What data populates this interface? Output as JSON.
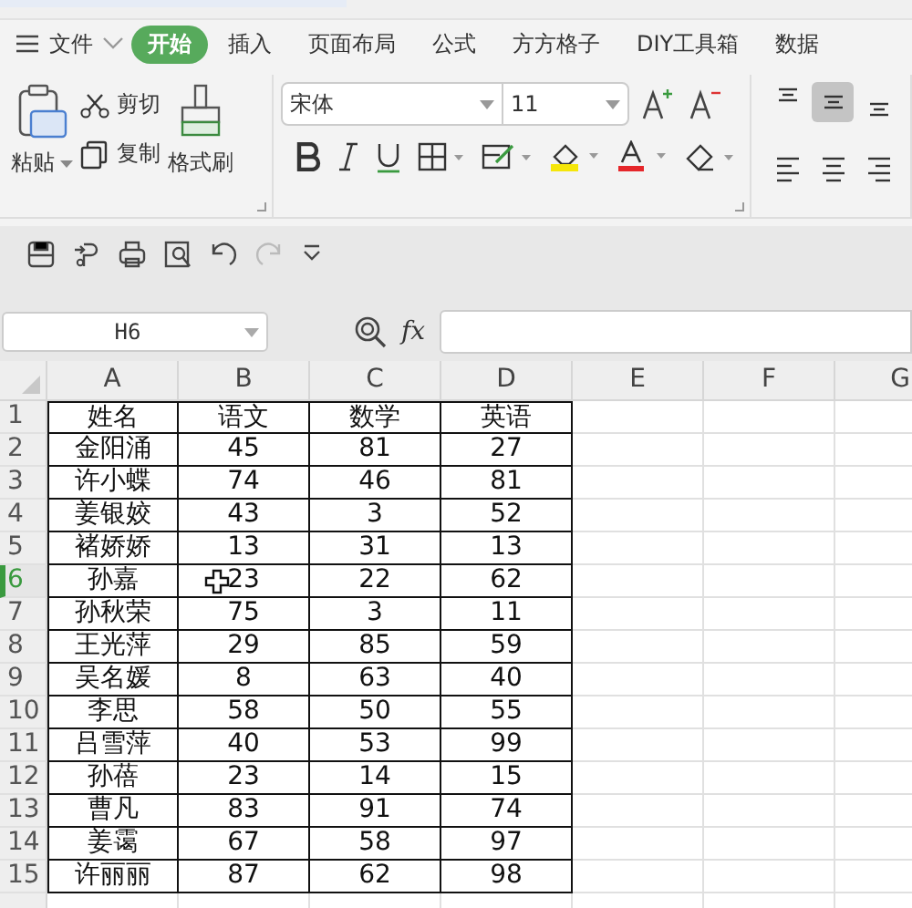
{
  "menu": {
    "label": "文件"
  },
  "tabs": [
    {
      "label": "开始",
      "selected": true
    },
    {
      "label": "插入",
      "selected": false
    },
    {
      "label": "页面布局",
      "selected": false
    },
    {
      "label": "公式",
      "selected": false
    },
    {
      "label": "方方格子",
      "selected": false
    },
    {
      "label": "DIY工具箱",
      "selected": false
    },
    {
      "label": "数据",
      "selected": false
    }
  ],
  "clipboard": {
    "paste": "粘贴",
    "cut": "剪切",
    "copy": "复制",
    "format_painter": "格式刷"
  },
  "font": {
    "name": "宋体",
    "size": "11"
  },
  "alignment": [
    {
      "kind": "top",
      "selected": false
    },
    {
      "kind": "middle",
      "selected": true
    },
    {
      "kind": "bottom",
      "selected": false
    },
    {
      "kind": "left",
      "selected": false
    },
    {
      "kind": "center",
      "selected": false
    },
    {
      "kind": "right",
      "selected": false
    }
  ],
  "name_box": {
    "value": "H6"
  },
  "formula_bar": {
    "label": "fx"
  },
  "sheet": {
    "columns": [
      "A",
      "B",
      "C",
      "D",
      "E",
      "F",
      "G"
    ],
    "rows": [
      {
        "number": "1",
        "selected": false,
        "cells": [
          "姓名",
          "语文",
          "数学",
          "英语"
        ]
      },
      {
        "number": "2",
        "selected": false,
        "cells": [
          "金阳涌",
          "45",
          "81",
          "27"
        ]
      },
      {
        "number": "3",
        "selected": false,
        "cells": [
          "许小蝶",
          "74",
          "46",
          "81"
        ]
      },
      {
        "number": "4",
        "selected": false,
        "cells": [
          "姜银姣",
          "43",
          "3",
          "52"
        ]
      },
      {
        "number": "5",
        "selected": false,
        "cells": [
          "褚娇娇",
          "13",
          "31",
          "13"
        ]
      },
      {
        "number": "6",
        "selected": true,
        "cells": [
          "孙嘉",
          "23",
          "22",
          "62"
        ]
      },
      {
        "number": "7",
        "selected": false,
        "cells": [
          "孙秋荣",
          "75",
          "3",
          "11"
        ]
      },
      {
        "number": "8",
        "selected": false,
        "cells": [
          "王光萍",
          "29",
          "85",
          "59"
        ]
      },
      {
        "number": "9",
        "selected": false,
        "cells": [
          "吴名媛",
          "8",
          "63",
          "40"
        ]
      },
      {
        "number": "10",
        "selected": false,
        "cells": [
          "李思",
          "58",
          "50",
          "55"
        ]
      },
      {
        "number": "11",
        "selected": false,
        "cells": [
          "吕雪萍",
          "40",
          "53",
          "99"
        ]
      },
      {
        "number": "12",
        "selected": false,
        "cells": [
          "孙蓓",
          "23",
          "14",
          "15"
        ]
      },
      {
        "number": "13",
        "selected": false,
        "cells": [
          "曹凡",
          "83",
          "91",
          "74"
        ]
      },
      {
        "number": "14",
        "selected": false,
        "cells": [
          "姜霭",
          "67",
          "58",
          "97"
        ]
      },
      {
        "number": "15",
        "selected": false,
        "cells": [
          "许丽丽",
          "87",
          "62",
          "98"
        ]
      }
    ]
  }
}
